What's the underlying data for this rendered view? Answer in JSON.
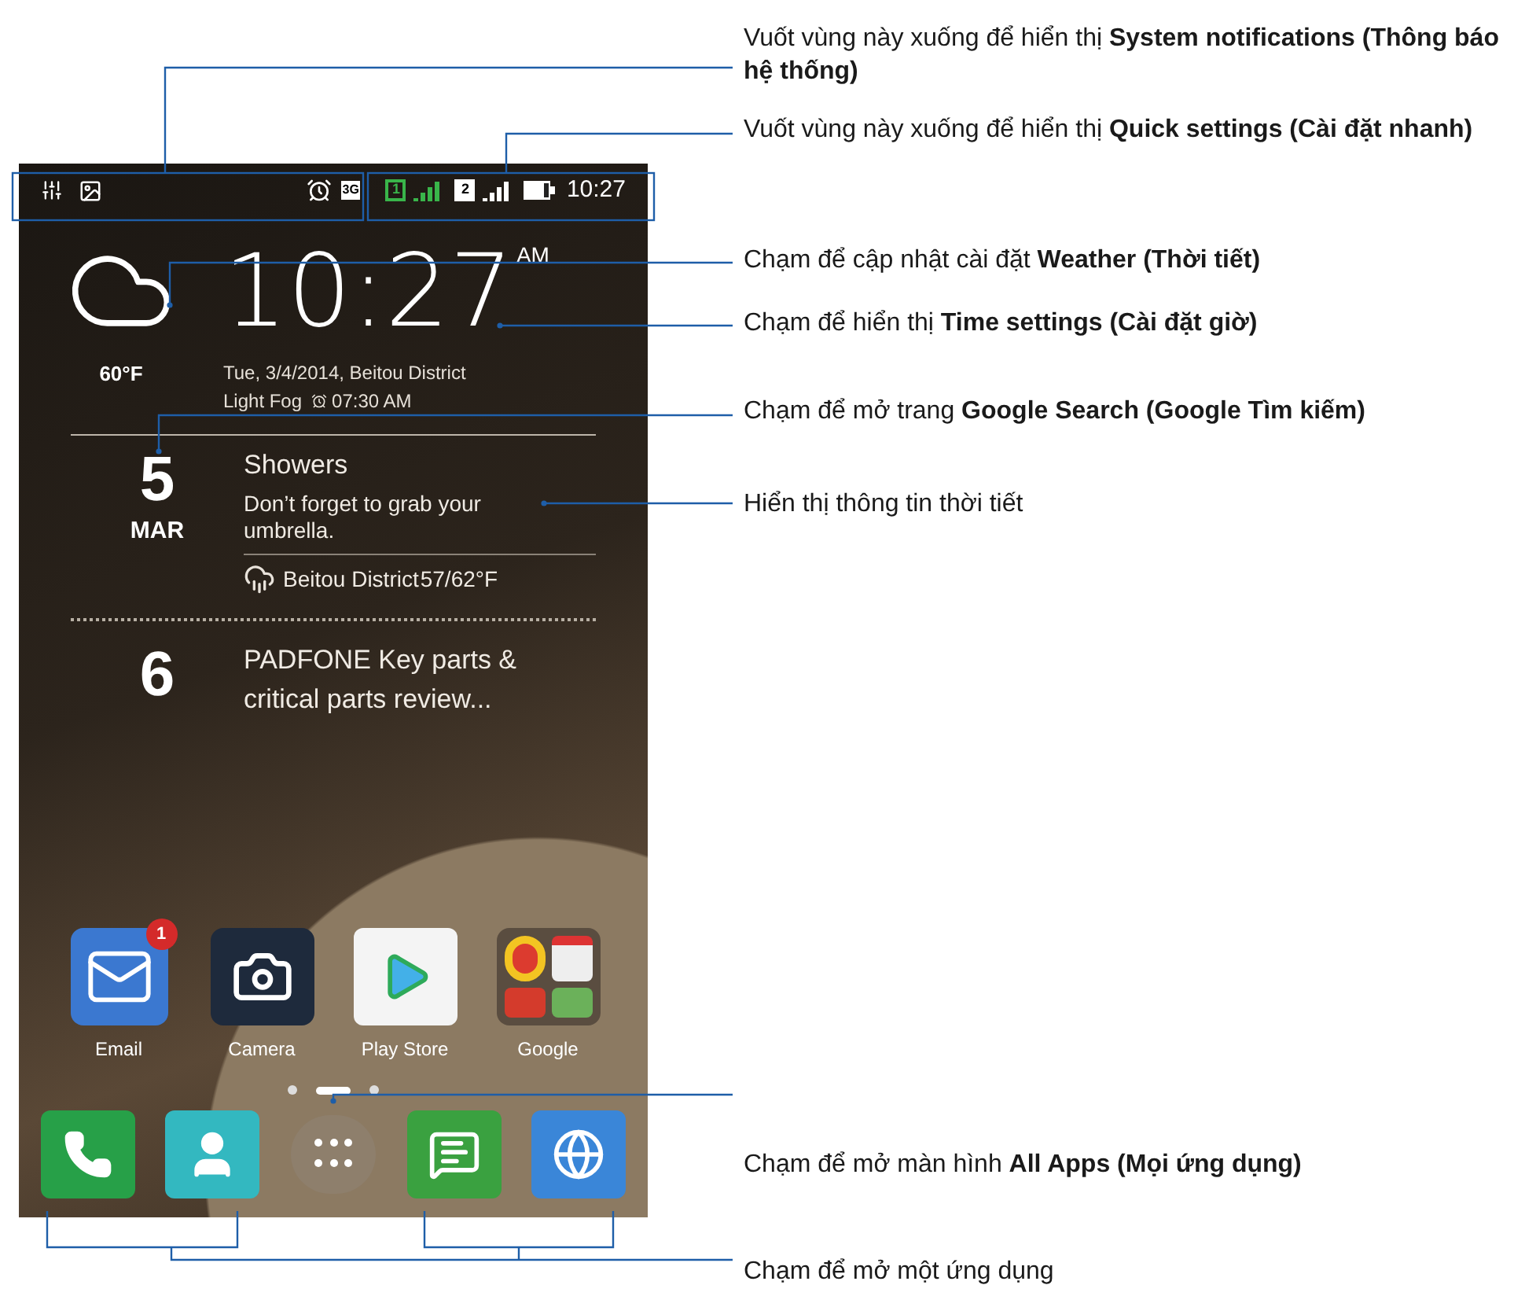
{
  "status_bar": {
    "sim_1": "1",
    "sim_2": "2",
    "network": "3G",
    "time": "10:27"
  },
  "clock_widget": {
    "temperature": "60°F",
    "time": "10:27",
    "meridiem": "AM",
    "date_line": "Tue, 3/4/2014, Beitou District",
    "weather": "Light Fog",
    "alarm": "07:30 AM"
  },
  "agenda": [
    {
      "kind": "weather_event",
      "day": "5",
      "month": "MAR",
      "title": "Showers",
      "note": "Don’t forget to grab your umbrella.",
      "location": "Beitou District",
      "temperature": "57/62°F"
    },
    {
      "kind": "event",
      "day": "6",
      "title": "PADFONE Key parts & critical parts review..."
    }
  ],
  "apps": [
    {
      "kind": "email",
      "label": "Email",
      "badge": "1"
    },
    {
      "kind": "camera",
      "label": "Camera"
    },
    {
      "kind": "store",
      "label": "Play Store"
    },
    {
      "kind": "folder",
      "label": "Google"
    }
  ],
  "page_dots": [
    {
      "selected": false
    },
    {
      "selected": true
    },
    {
      "selected": false
    }
  ],
  "dock": [
    {
      "kind": "phone"
    },
    {
      "kind": "contacts"
    },
    {
      "kind": "all_apps"
    },
    {
      "kind": "messages"
    },
    {
      "kind": "browser"
    }
  ],
  "annotations": [
    {
      "text": "Vuốt vùng này xuống để hiển thị **System notifications (Thông báo hệ thống)**"
    },
    {
      "text": "Vuốt vùng này xuống để hiển thị **Quick settings (Cài đặt nhanh)**"
    },
    {
      "text": "Chạm để cập nhật cài đặt **Weather (Thời tiết)**"
    },
    {
      "text": "Chạm để hiển thị **Time settings (Cài đặt giờ)**"
    },
    {
      "text": "Chạm để mở trang **Google Search (Google Tìm kiếm)**"
    },
    {
      "text": "Hiển thị thông tin thời tiết"
    },
    {
      "text": "Chạm để mở màn hình **All Apps (Mọi ứng dụng)**"
    },
    {
      "text": "Chạm để mở một ứng dụng"
    }
  ]
}
